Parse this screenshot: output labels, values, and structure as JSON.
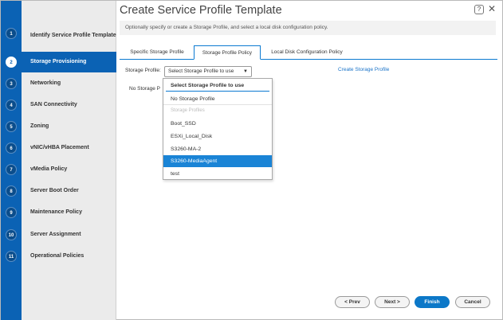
{
  "header": {
    "title": "Create Service Profile Template",
    "subtitle": "Optionally specify or create a Storage Profile, and select a local disk configuration policy.",
    "help_label": "?",
    "close_label": "✕"
  },
  "steps": [
    {
      "number": "1",
      "label": "Identify Service Profile Template"
    },
    {
      "number": "2",
      "label": "Storage Provisioning"
    },
    {
      "number": "3",
      "label": "Networking"
    },
    {
      "number": "4",
      "label": "SAN Connectivity"
    },
    {
      "number": "5",
      "label": "Zoning"
    },
    {
      "number": "6",
      "label": "vNIC/vHBA Placement"
    },
    {
      "number": "7",
      "label": "vMedia Policy"
    },
    {
      "number": "8",
      "label": "Server Boot Order"
    },
    {
      "number": "9",
      "label": "Maintenance Policy"
    },
    {
      "number": "10",
      "label": "Server Assignment"
    },
    {
      "number": "11",
      "label": "Operational Policies"
    }
  ],
  "tabs": [
    {
      "label": "Specific Storage Profile"
    },
    {
      "label": "Storage Profile Policy"
    },
    {
      "label": "Local Disk Configuration Policy"
    }
  ],
  "storage": {
    "field_label": "Storage Profile:",
    "select_value": "Select Storage Profile to use",
    "create_link": "Create Storage Profile",
    "hidden_text": "No Storage P"
  },
  "dropdown": {
    "header": "Select Storage Profile to use",
    "items": [
      {
        "label": "No Storage Profile"
      },
      {
        "label": "Storage Profiles"
      },
      {
        "label": "Boot_SSD"
      },
      {
        "label": "ESXi_Local_Disk"
      },
      {
        "label": "S3260-MA-2"
      },
      {
        "label": "S3260-MediaAgent"
      },
      {
        "label": "test"
      }
    ]
  },
  "footer": {
    "prev": "< Prev",
    "next": "Next >",
    "finish": "Finish",
    "cancel": "Cancel"
  }
}
